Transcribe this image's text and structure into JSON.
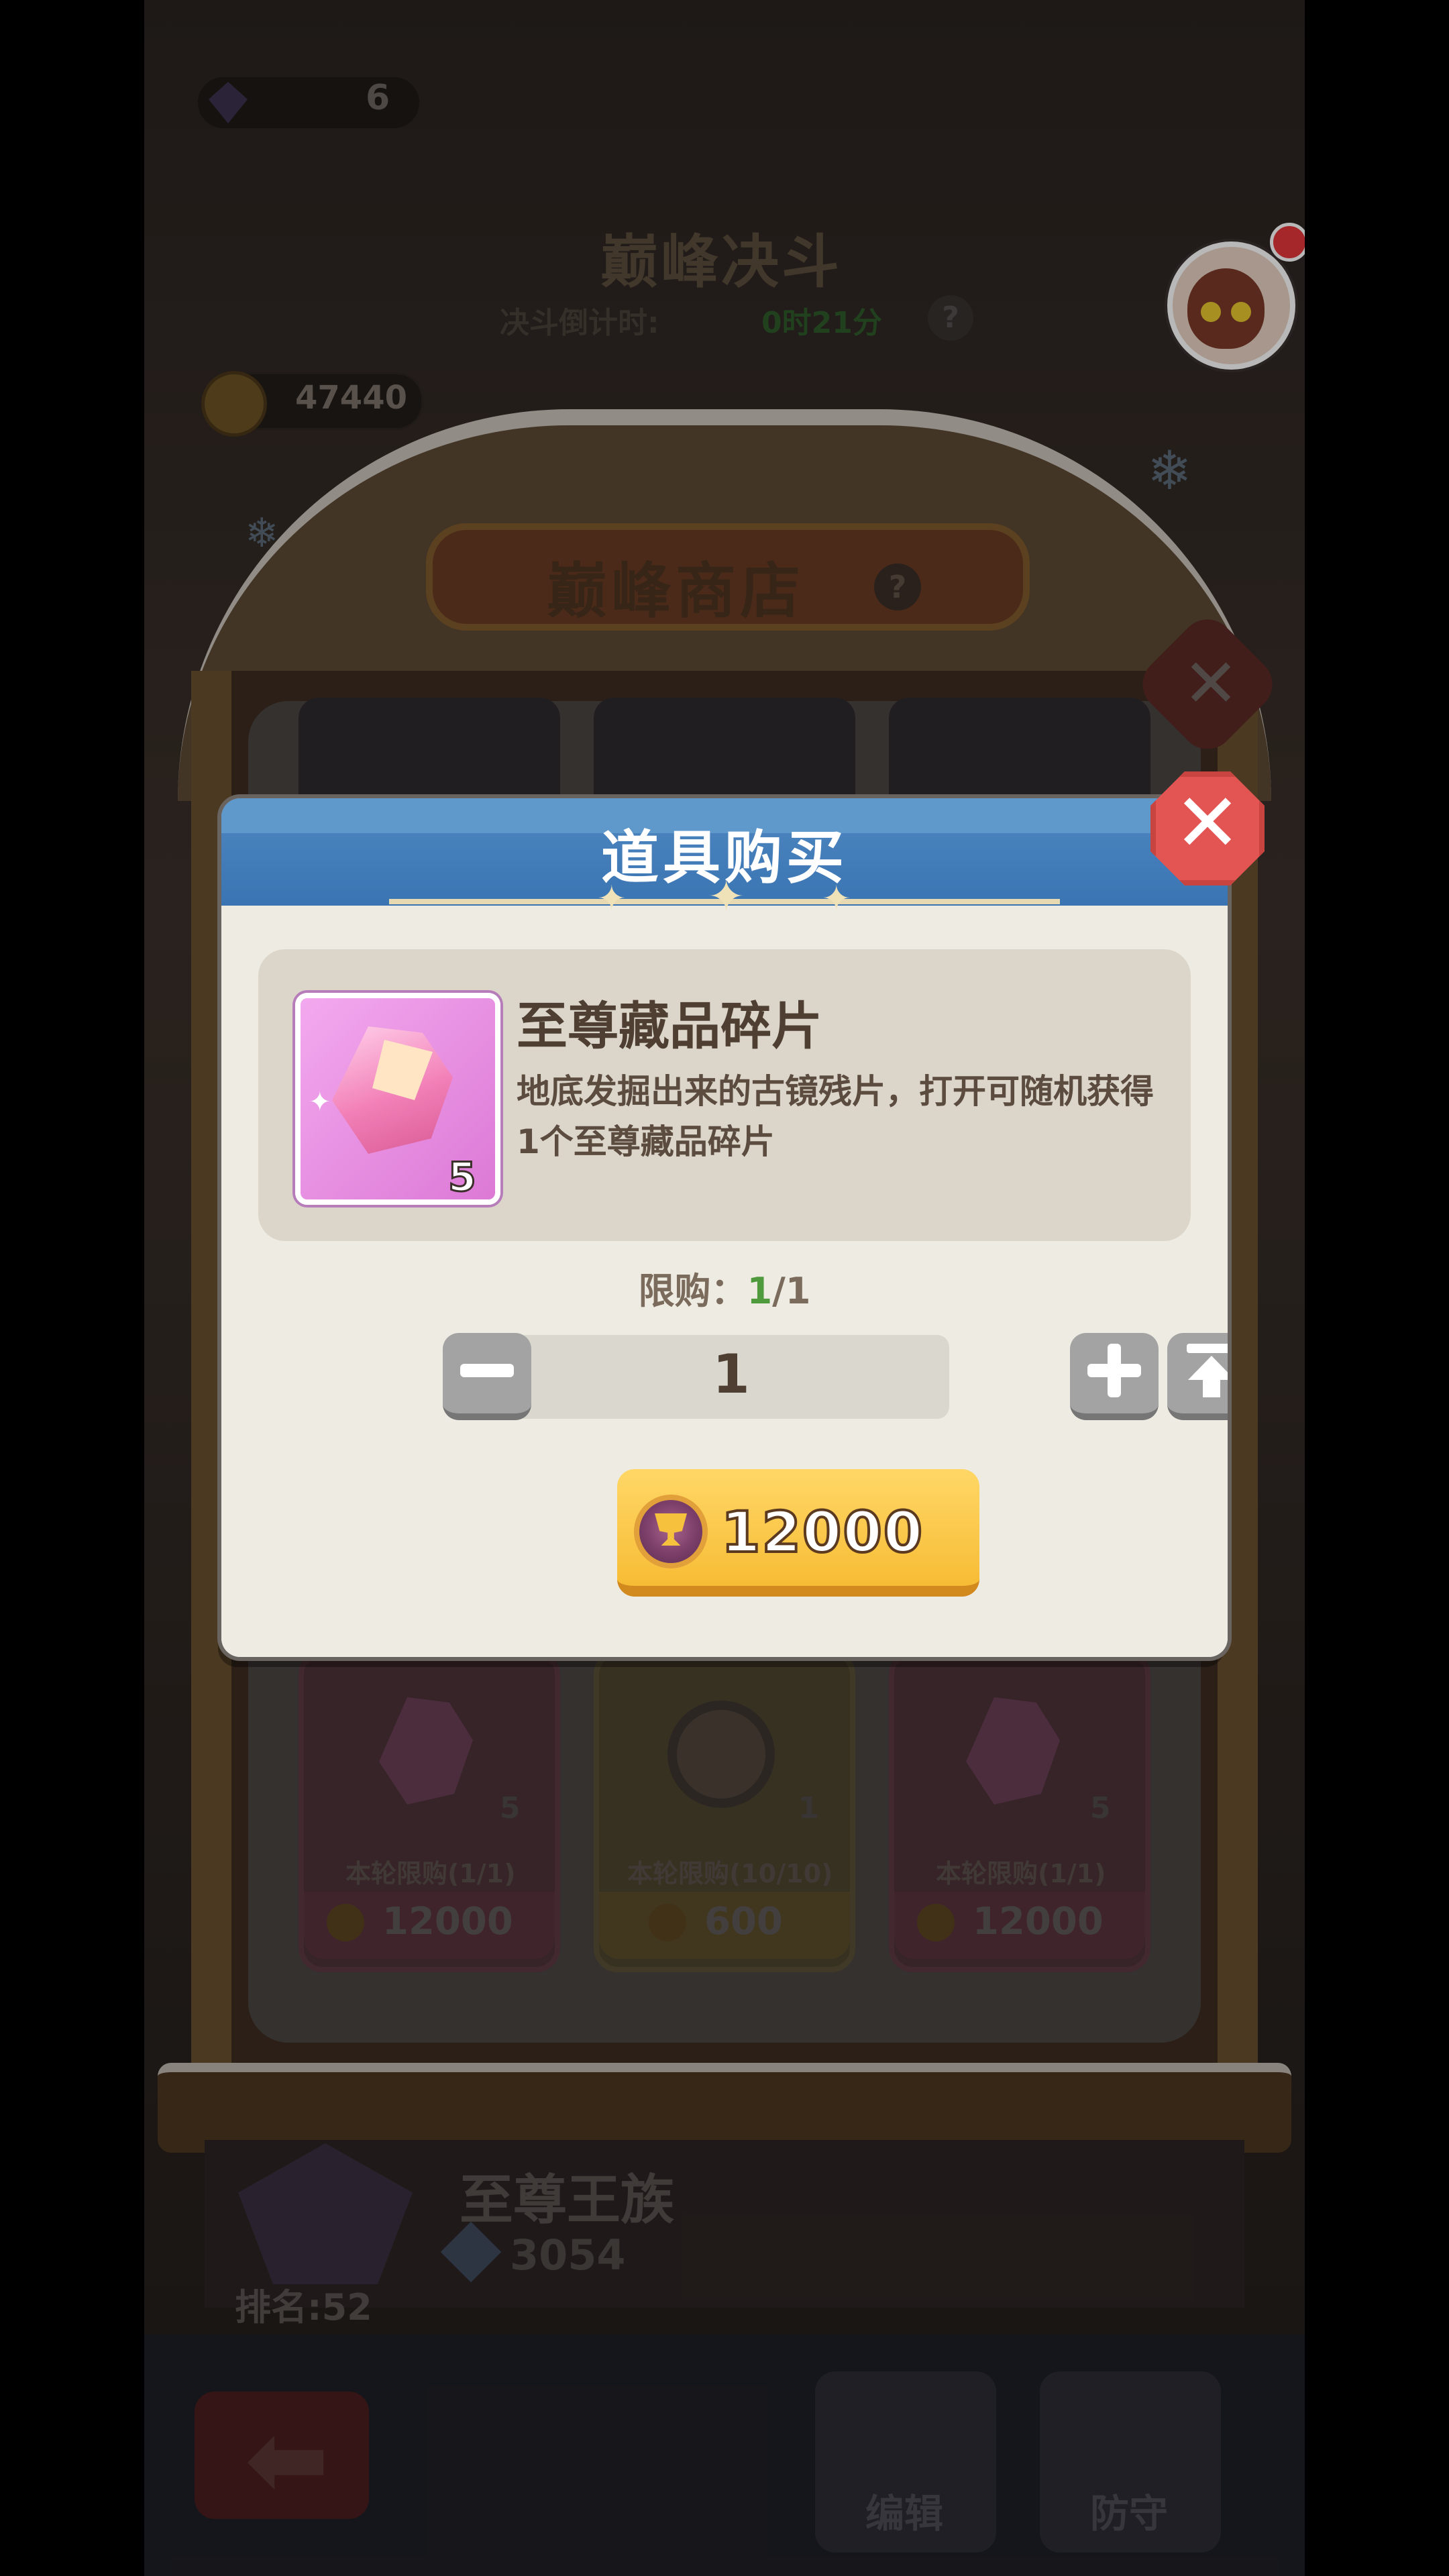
{
  "background": {
    "gem_count": "6",
    "event_title": "巅峰决斗",
    "countdown_label": "决斗倒计时:",
    "countdown_value": "0时21分",
    "trophy_count": "47440",
    "shop_title": "巅峰商店",
    "shop_items": [
      {
        "qty": "5",
        "limit": "本轮限购(1/1)",
        "price": "12000"
      },
      {
        "qty": "1",
        "limit": "本轮限购(10/10)",
        "price": "600"
      },
      {
        "qty": "5",
        "limit": "本轮限购(1/1)",
        "price": "12000"
      }
    ],
    "player": {
      "tier_name": "至尊王族",
      "score": "3054",
      "rank": "排名:52"
    },
    "dock": {
      "left_label": "编辑",
      "right_label": "防守"
    }
  },
  "dialog": {
    "title": "道具购买",
    "item": {
      "name": "至尊藏品碎片",
      "description": "地底发掘出来的古镜残片，打开可随机获得1个至尊藏品碎片",
      "quantity_badge": "5"
    },
    "limit_label": "限购：",
    "limit_current": "1",
    "limit_total": "/1",
    "quantity": "1",
    "price": "12000"
  },
  "colors": {
    "header_blue": "#3a74b2",
    "close_red": "#e25553",
    "buy_gold": "#f7bc35",
    "limit_green": "#4f9a3c"
  },
  "icons": [
    "gem-icon",
    "trophy-icon",
    "question-icon",
    "snowflake-icon",
    "close-icon",
    "minus-icon",
    "plus-icon",
    "max-icon",
    "coin-icon",
    "back-arrow-icon"
  ]
}
